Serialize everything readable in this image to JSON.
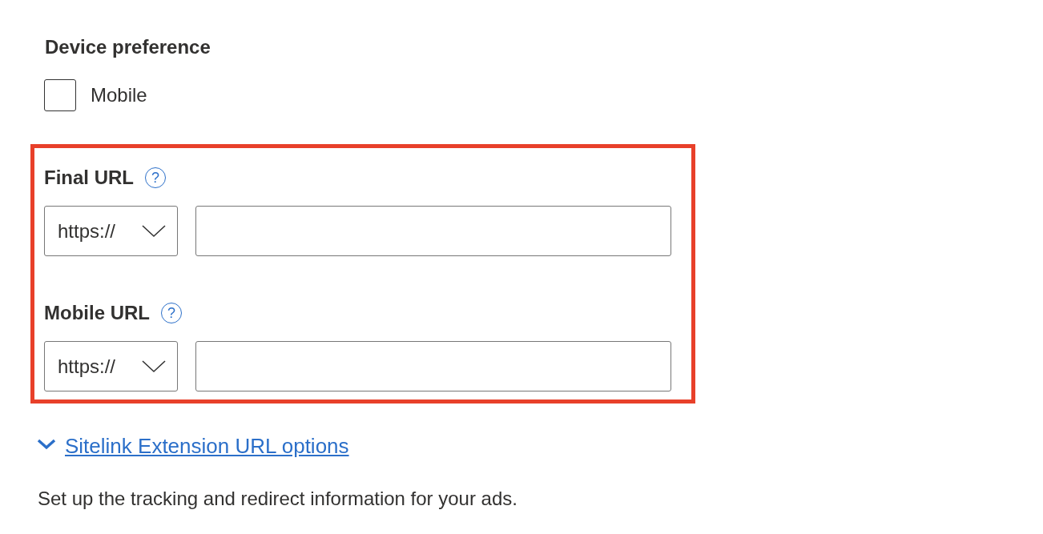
{
  "device_preference": {
    "title": "Device preference",
    "options": [
      {
        "label": "Mobile",
        "checked": false
      }
    ]
  },
  "url_fields": [
    {
      "label": "Final URL",
      "help": "?",
      "protocol": "https://"
    },
    {
      "label": "Mobile URL",
      "help": "?",
      "protocol": "https://"
    }
  ],
  "options_link": {
    "label": "Sitelink Extension URL options",
    "expanded": true
  },
  "description": "Set up the tracking and redirect information for your ads."
}
